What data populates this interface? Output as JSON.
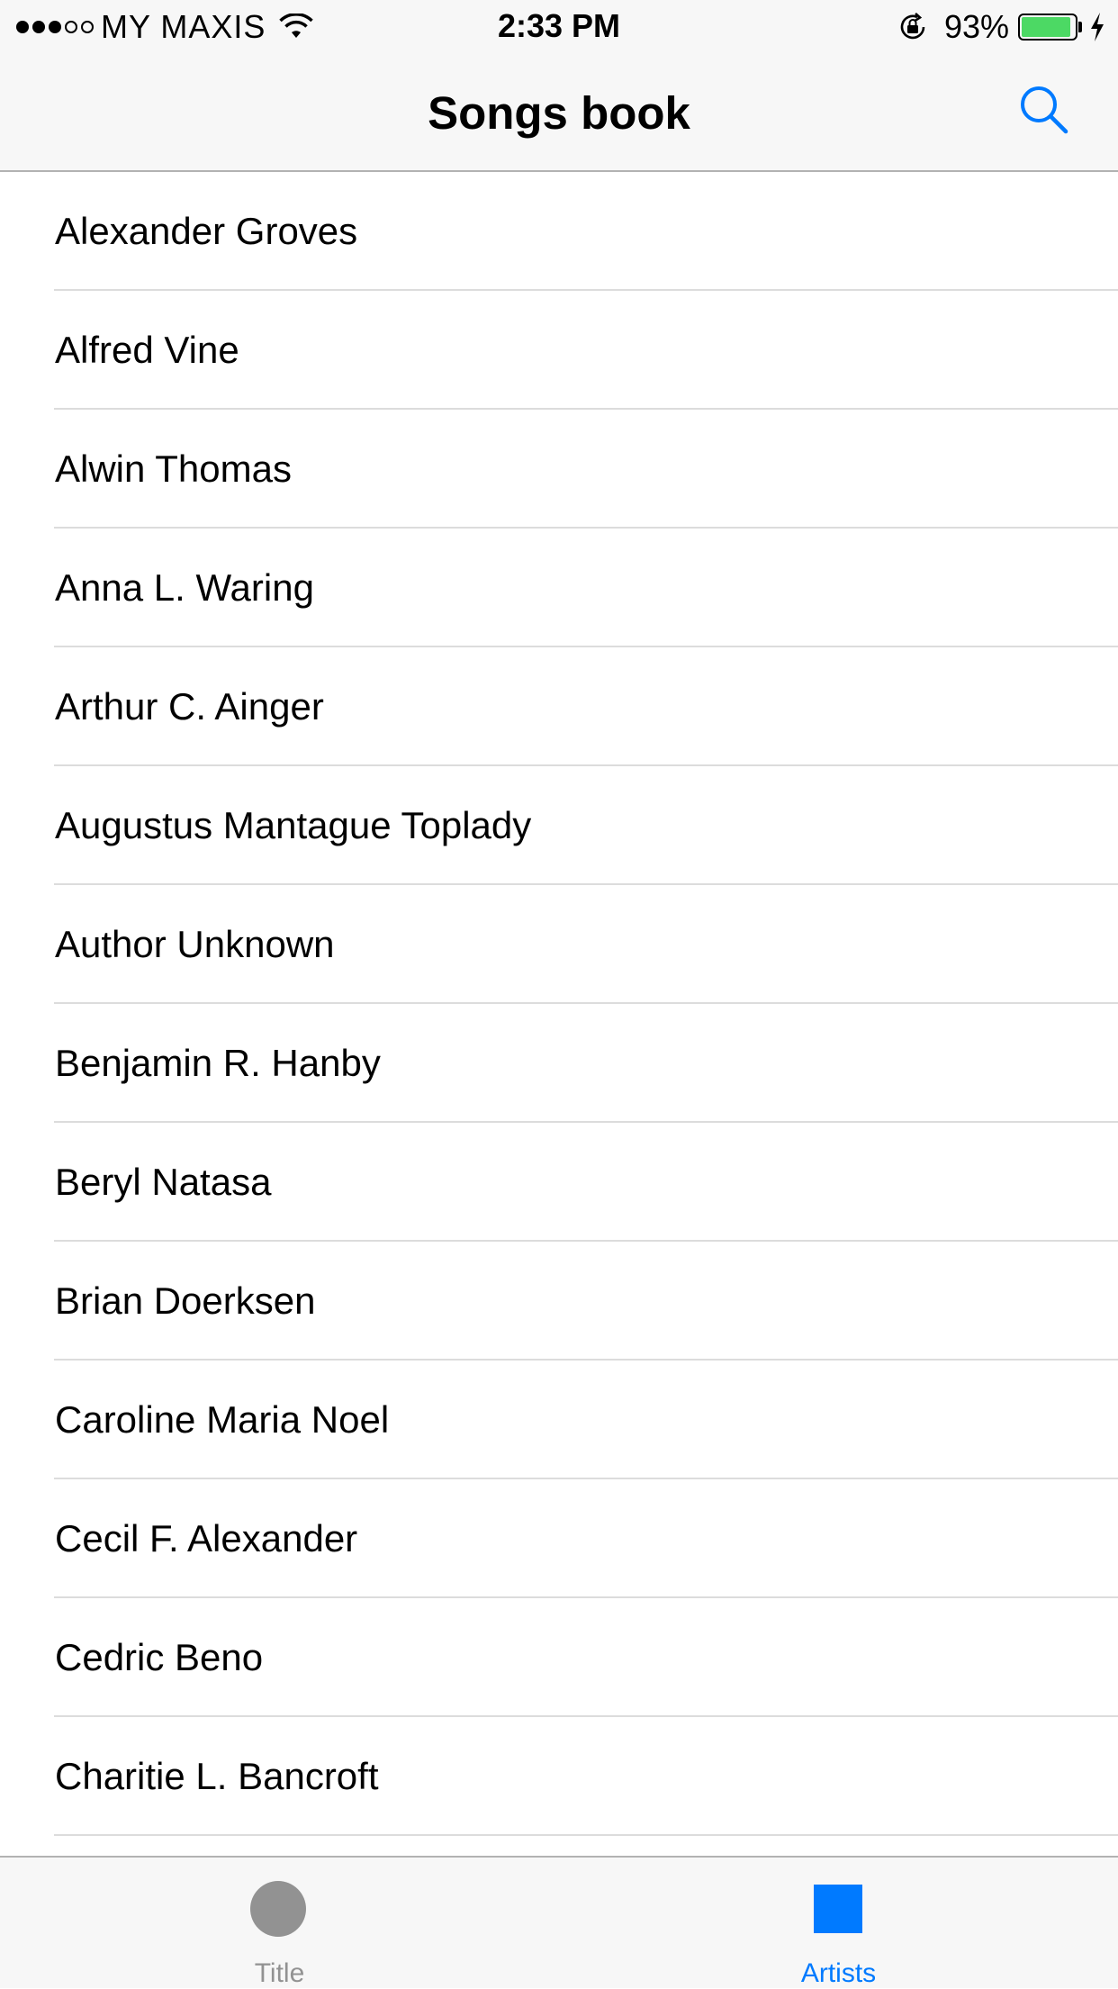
{
  "status_bar": {
    "carrier": "MY MAXIS",
    "time": "2:33 PM",
    "battery_percent": "93%",
    "battery_level": 0.93,
    "signal_strength": 3,
    "signal_max": 5,
    "icons": [
      "signal-dots-icon",
      "wifi-icon",
      "rotation-lock-icon",
      "battery-icon",
      "charging-bolt-icon"
    ]
  },
  "nav": {
    "title": "Songs book",
    "search_icon": "search-icon"
  },
  "artists": [
    "Alexander Groves",
    "Alfred Vine",
    "Alwin Thomas",
    "Anna L. Waring",
    "Arthur C. Ainger",
    "Augustus Mantague Toplady",
    "Author Unknown",
    "Benjamin R. Hanby",
    "Beryl Natasa",
    "Brian Doerksen",
    "Caroline Maria Noel",
    "Cecil F. Alexander",
    "Cedric Beno",
    "Charitie L. Bancroft"
  ],
  "tab_bar": {
    "tabs": [
      {
        "label": "Title",
        "icon": "circle-icon",
        "selected": false
      },
      {
        "label": "Artists",
        "icon": "square-icon",
        "selected": true
      }
    ]
  },
  "colors": {
    "accent": "#007aff",
    "inactive": "#929292",
    "battery": "#4cd964",
    "bar_background": "#f7f7f7"
  }
}
